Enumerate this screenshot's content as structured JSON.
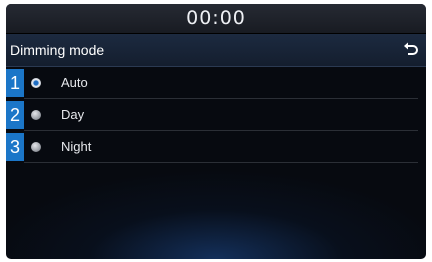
{
  "status": {
    "clock": "00:00"
  },
  "header": {
    "title": "Dimming mode",
    "back_icon": "back-arrow-icon"
  },
  "options": [
    {
      "number": "1",
      "label": "Auto",
      "selected": true
    },
    {
      "number": "2",
      "label": "Day",
      "selected": false
    },
    {
      "number": "3",
      "label": "Night",
      "selected": false
    }
  ],
  "colors": {
    "callout": "#1b76c8",
    "selected_radio": "#1f6ec4",
    "background": "#070a10"
  }
}
